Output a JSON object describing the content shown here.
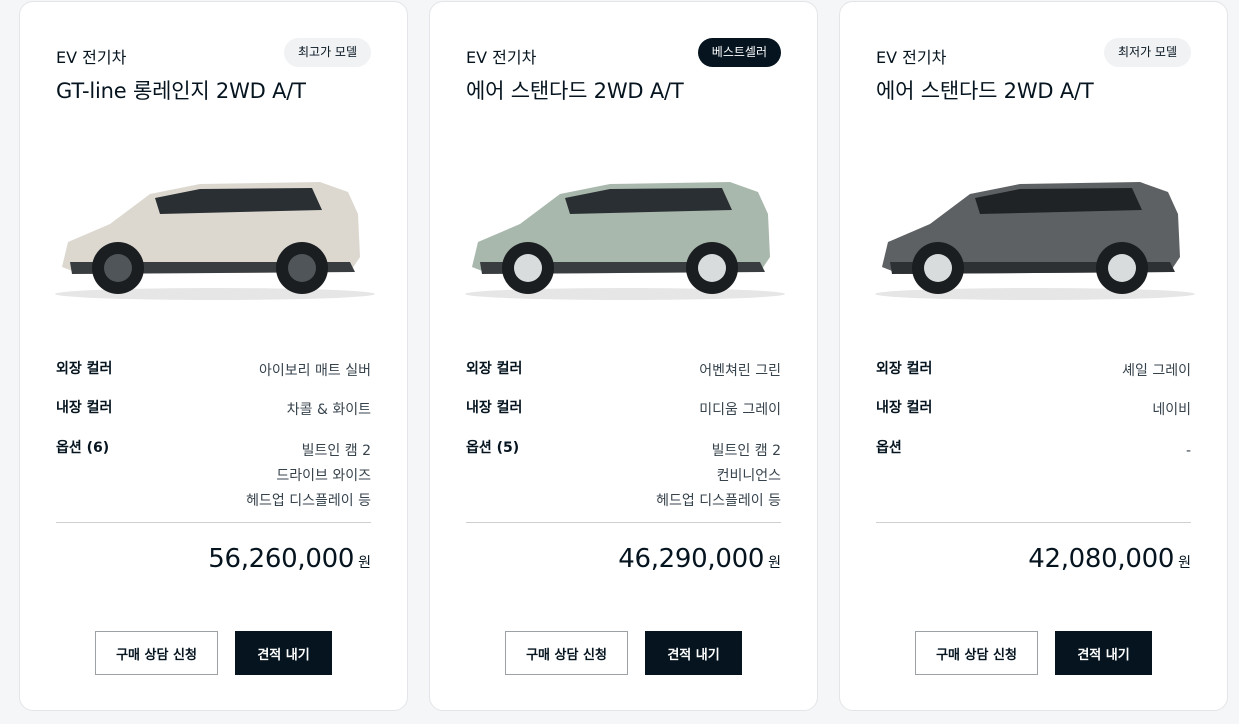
{
  "cards": [
    {
      "category": "EV 전기차",
      "badge": "최고가 모델",
      "model": "GT-line 롱레인지 2WD A/T",
      "specs": {
        "exterior_label": "외장 컬러",
        "exterior_value": "아이보리 매트 실버",
        "interior_label": "내장 컬러",
        "interior_value": "차콜 & 화이트",
        "options_label": "옵션 (6)",
        "options": [
          "빌트인 캠 2",
          "드라이브 와이즈",
          "헤드업 디스플레이 등"
        ]
      },
      "price": "56,260,000",
      "price_unit": "원",
      "consult_label": "구매 상담 신청",
      "estimate_label": "견적 내기",
      "car_color": "#dcd8d0"
    },
    {
      "category": "EV 전기차",
      "badge": "베스트셀러",
      "model": "에어 스탠다드 2WD A/T",
      "specs": {
        "exterior_label": "외장 컬러",
        "exterior_value": "어벤쳐린 그린",
        "interior_label": "내장 컬러",
        "interior_value": "미디움 그레이",
        "options_label": "옵션 (5)",
        "options": [
          "빌트인 캠 2",
          "컨비니언스",
          "헤드업 디스플레이 등"
        ]
      },
      "price": "46,290,000",
      "price_unit": "원",
      "consult_label": "구매 상담 신청",
      "estimate_label": "견적 내기",
      "car_color": "#a9b8ad"
    },
    {
      "category": "EV 전기차",
      "badge": "최저가 모델",
      "model": "에어 스탠다드 2WD A/T",
      "specs": {
        "exterior_label": "외장 컬러",
        "exterior_value": "셰일 그레이",
        "interior_label": "내장 컬러",
        "interior_value": "네이비",
        "options_label": "옵션",
        "options": [
          "-"
        ]
      },
      "price": "42,080,000",
      "price_unit": "원",
      "consult_label": "구매 상담 신청",
      "estimate_label": "견적 내기",
      "car_color": "#5e6164"
    }
  ],
  "colors": {
    "brand_dark": "#05141f",
    "badge_light": "#f1f2f4",
    "divider": "#cdd0d2"
  }
}
